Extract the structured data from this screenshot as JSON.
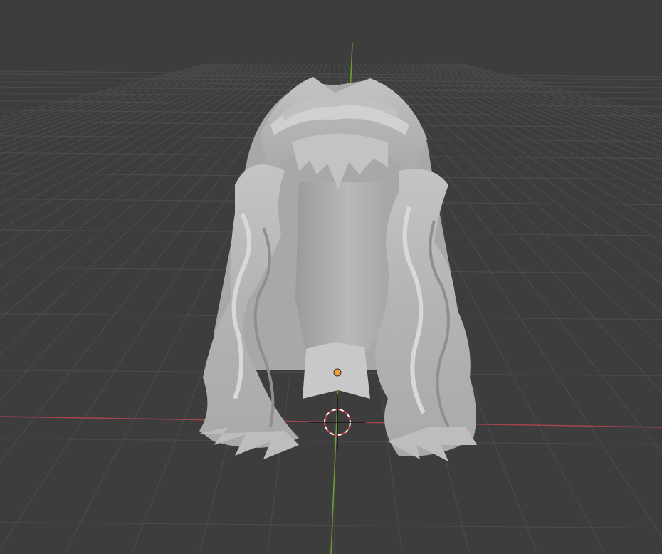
{
  "app": "3D viewport",
  "viewport": {
    "background": "#3d3d3d",
    "grid_color": "#4a4a4a",
    "x_axis_color": "#a3434f",
    "y_axis_color": "#6e9f2e",
    "object": {
      "name": "hair-mesh",
      "color": "#b9b9b9",
      "shadow_color": "#8c8c8c",
      "highlight_color": "#d6d6d6"
    },
    "origin_dot_color": "#f0a030",
    "cursor_color": "#e04040"
  }
}
